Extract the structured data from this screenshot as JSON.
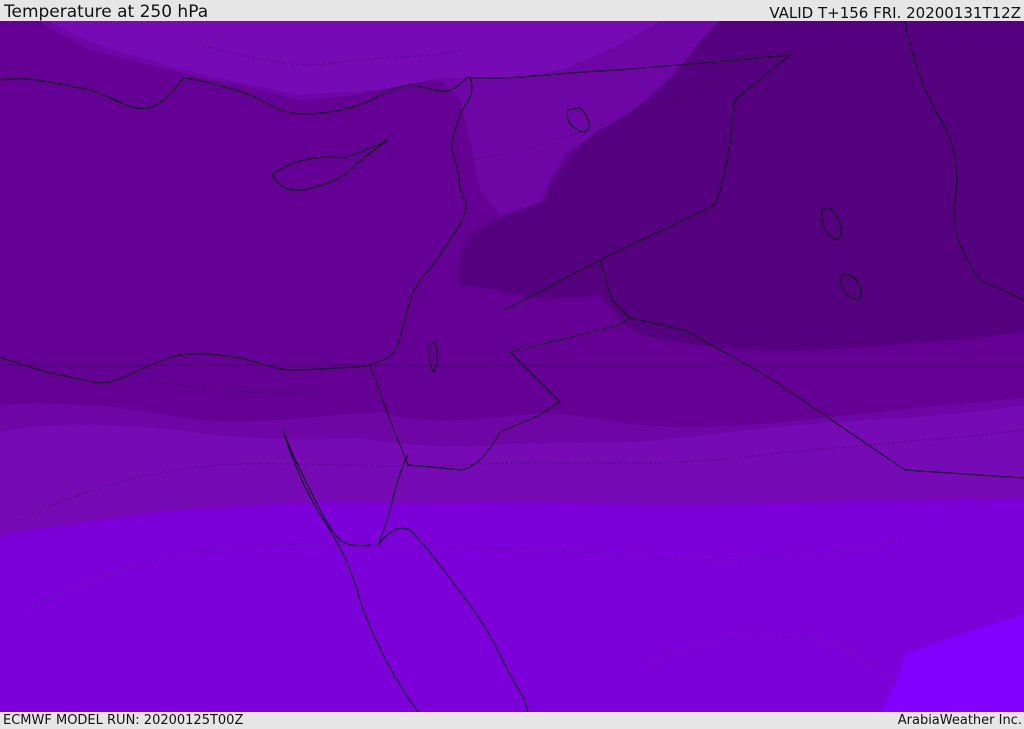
{
  "header": {
    "title": "Temperature at 250 hPa",
    "valid": "VALID T+156 FRI. 20200131T12Z"
  },
  "footer": {
    "model_run": "ECMWF MODEL RUN: 20200125T00Z",
    "credit": "ArabiaWeather Inc."
  },
  "map": {
    "colors": {
      "coldest": "#54007f",
      "band_2": "#640094",
      "band_3": "#6e06a6",
      "band_4": "#760ab4",
      "band_5": "#7c00d8",
      "warmest": "#8200ff",
      "coastline": "#000000"
    }
  }
}
